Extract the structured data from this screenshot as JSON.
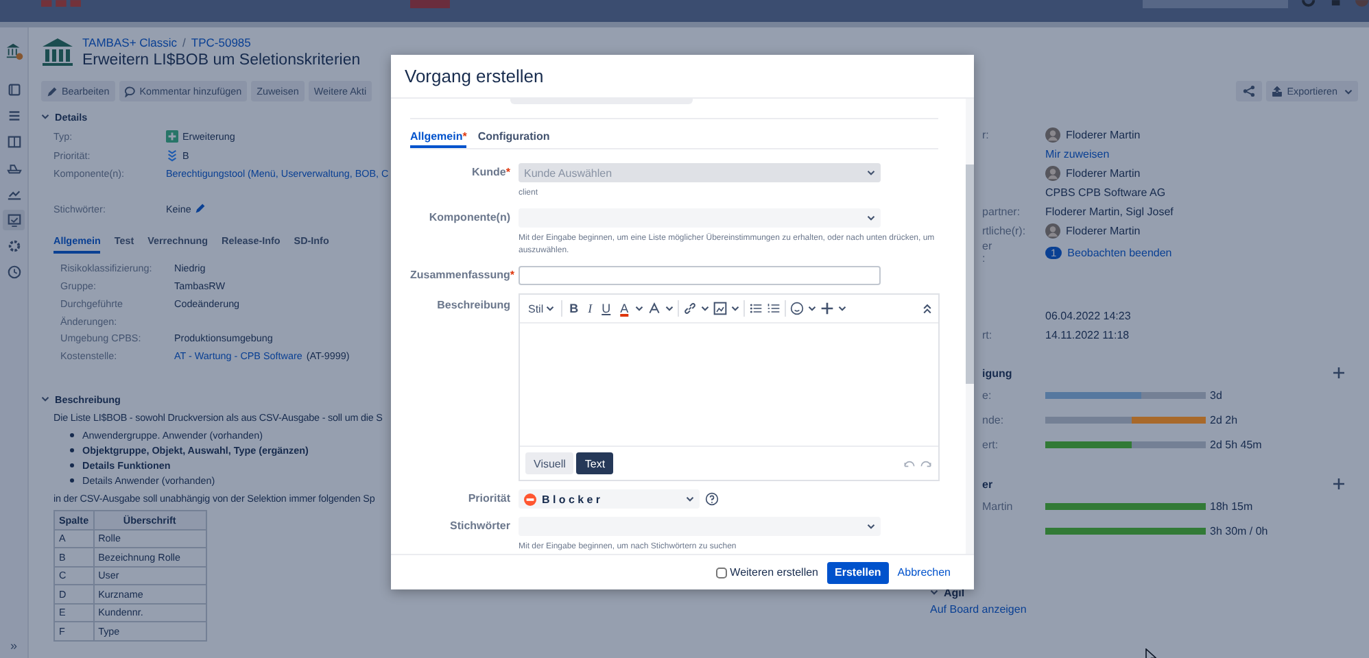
{
  "sidebar": {
    "items": [
      {
        "selected": false
      },
      {
        "selected": false
      },
      {
        "selected": false
      },
      {
        "selected": false
      },
      {
        "selected": false
      },
      {
        "selected": false
      },
      {
        "selected": true
      },
      {
        "selected": false
      },
      {
        "selected": false
      }
    ],
    "expand": "»"
  },
  "issue": {
    "project": "TAMBAS+ Classic",
    "separator": "/",
    "key": "TPC-50985",
    "title": "Erweitern LI$BOB um Seletionskriterien"
  },
  "toolbar": {
    "buttons": [
      {
        "kind": "edit",
        "label": "Bearbeiten"
      },
      {
        "kind": "comment",
        "label": "Kommentar hinzufügen"
      },
      {
        "kind": "plain",
        "label": "Zuweisen"
      },
      {
        "kind": "plain",
        "label": "Weitere Akti"
      }
    ],
    "export": "Exportieren"
  },
  "details": {
    "heading": "Details",
    "expanded": true,
    "fields": [
      {
        "kind": "type",
        "label": "Typ:",
        "value": "Erweiterung"
      },
      {
        "kind": "priority",
        "label": "Priorität:",
        "value": "B"
      },
      {
        "kind": "link",
        "label": "Komponente(n):",
        "value": "Berechtigungstool (Menü, Userverwaltung, BOB, C"
      },
      {
        "kind": "editable",
        "label": "Stichwörter:",
        "value": "Keine"
      }
    ]
  },
  "detail_tabs": [
    {
      "label": "Allgemein",
      "selected": true
    },
    {
      "label": "Test",
      "selected": false
    },
    {
      "label": "Verrechnung",
      "selected": false
    },
    {
      "label": "Release-Info",
      "selected": false
    },
    {
      "label": "SD-Info",
      "selected": false
    }
  ],
  "tab_fields": [
    {
      "kind": "text",
      "label": "Risikoklassifizierung:",
      "value": "Niedrig"
    },
    {
      "kind": "text",
      "label": "Gruppe:",
      "value": "TambasRW"
    },
    {
      "kind": "text",
      "label": "Durchgeführte Änderungen:",
      "value": "Codeänderung"
    },
    {
      "kind": "text",
      "label": "Umgebung CPBS:",
      "value": "Produktionsumgebung"
    },
    {
      "kind": "link",
      "label": "Kostenstelle:",
      "value": "AT - Wartung - CPB Software",
      "suffix": "(AT-9999)"
    }
  ],
  "description": {
    "heading": "Beschreibung",
    "expanded": true,
    "intro": "Die Liste LI$BOB - sowohl Druckversion als aus CSV-Ausgabe - soll um die S",
    "bullets": [
      {
        "text": "Anwendergruppe. Anwender (vorhanden)",
        "bold": false
      },
      {
        "text": "Objektgruppe, Objekt, Auswahl, Type (ergänzen)",
        "bold": true
      },
      {
        "text": "Details Funktionen",
        "bold": true
      },
      {
        "text": "Details Anwender (vorhanden)",
        "bold": false
      }
    ],
    "outro": "in der CSV-Ausgabe soll unabhängig von der Selektion immer folgenden Sp",
    "table": {
      "columns": [
        "Spalte",
        "Überschrift"
      ],
      "rows": [
        [
          "A",
          "Rolle"
        ],
        [
          "B",
          "Bezeichnung Rolle"
        ],
        [
          "C",
          "User"
        ],
        [
          "D",
          "Kurzname"
        ],
        [
          "E",
          "Kundennr."
        ],
        [
          "F",
          "Type"
        ]
      ]
    }
  },
  "people": [
    {
      "kind": "user",
      "label": "r:",
      "value": "Floderer Martin"
    },
    {
      "kind": "link",
      "value": "Mir zuweisen"
    },
    {
      "kind": "user",
      "value": "Floderer Martin"
    },
    {
      "kind": "text",
      "value": "CPBS CPB Software AG"
    },
    {
      "kind": "text",
      "label": "partner:",
      "value": "Floderer Martin, Sigl Josef"
    },
    {
      "kind": "user",
      "label": "rtliche(r):",
      "value": "Floderer Martin"
    },
    {
      "kind": "watch",
      "label": "er",
      "label_2": ":",
      "count": "1",
      "value": "Beobachten beenden"
    }
  ],
  "dates": [
    {
      "value": "06.04.2022 14:23"
    },
    {
      "label": "rt:",
      "value": "14.11.2022 11:18"
    }
  ],
  "time_tracking": {
    "heading": "igung",
    "rows": [
      {
        "label": "e:",
        "kind": "left",
        "level": 0.6,
        "color": "#56789f",
        "reading": "3d"
      },
      {
        "label": "nde:",
        "kind": "right",
        "level": 0.46,
        "color": "#a8692a",
        "reading": "2d 2h"
      },
      {
        "label": "ert:",
        "kind": "left",
        "level": 0.54,
        "color": "#327a36",
        "reading": "2d 5h 45m"
      }
    ]
  },
  "workers": {
    "heading": "er",
    "rows": [
      {
        "label": "Martin",
        "level": 1,
        "color": "#327a36",
        "reading": "18h 15m"
      },
      {
        "level": 1,
        "color": "#327a36",
        "reading": "3h 30m / 0h"
      }
    ]
  },
  "agile": {
    "heading": "Agil",
    "expanded": true,
    "link": "Auf Board anzeigen"
  },
  "dialog": {
    "title": "Vorgang erstellen",
    "tabs": [
      {
        "label": "Allgemein",
        "mark": "*",
        "selected": true
      },
      {
        "label": "Configuration",
        "selected": false
      }
    ],
    "fields": [
      {
        "kind": "select",
        "label": "Kunde",
        "mark": "*",
        "placeholder": "Kunde Auswählen",
        "disabled": true,
        "hint": "client"
      },
      {
        "kind": "select",
        "label": "Komponente(n)",
        "disabled": false,
        "hint": "Mit der Eingabe beginnen, um eine Liste möglicher Übereinstimmungen zu erhalten, oder nach unten drücken, um auszuwählen."
      },
      {
        "kind": "text",
        "label": "Zusammenfassung",
        "mark": "*"
      },
      {
        "kind": "editor",
        "label": "Beschreibung",
        "style_label": "Stil",
        "format_buttons": [
          "B",
          "I",
          "U",
          "A"
        ],
        "modes": [
          {
            "label": "Visuell",
            "selected": false
          },
          {
            "label": "Text",
            "selected": true
          }
        ]
      },
      {
        "kind": "priority",
        "label": "Priorität",
        "value": "Blocker"
      },
      {
        "kind": "select",
        "label": "Stichwörter",
        "disabled": false,
        "hint": "Mit der Eingabe beginnen, um nach Stichwörtern zu suchen"
      }
    ],
    "footer": {
      "create_another": {
        "label": "Weiteren erstellen",
        "checked": false
      },
      "submit": "Erstellen",
      "cancel": "Abbrechen"
    }
  }
}
